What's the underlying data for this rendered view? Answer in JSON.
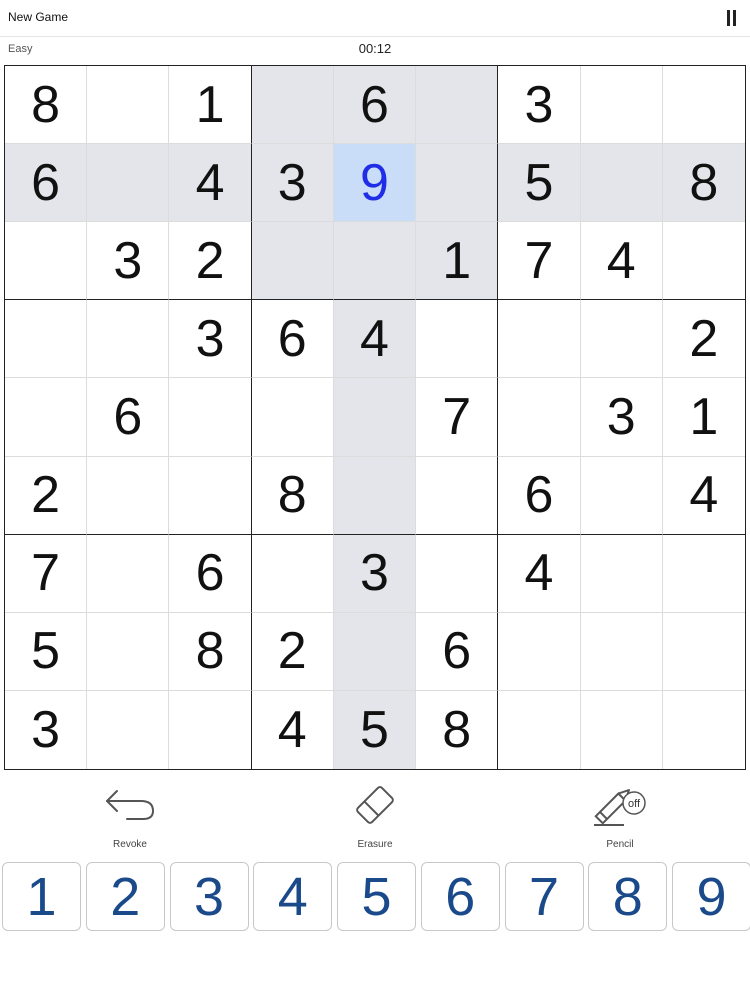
{
  "header": {
    "new_game": "New Game",
    "pause_icon": "pause-icon"
  },
  "info": {
    "difficulty": "Easy",
    "timer": "00:12"
  },
  "board": {
    "cells": [
      [
        "8",
        "",
        "1",
        "",
        "6",
        "",
        "3",
        "",
        ""
      ],
      [
        "6",
        "",
        "4",
        "3",
        "9",
        "",
        "5",
        "",
        "8"
      ],
      [
        "",
        "3",
        "2",
        "",
        "",
        "1",
        "7",
        "4",
        ""
      ],
      [
        "",
        "",
        "3",
        "6",
        "4",
        "",
        "",
        "",
        "2"
      ],
      [
        "",
        "6",
        "",
        "",
        "",
        "7",
        "",
        "3",
        "1"
      ],
      [
        "2",
        "",
        "",
        "8",
        "",
        "",
        "6",
        "",
        "4"
      ],
      [
        "7",
        "",
        "6",
        "",
        "3",
        "",
        "4",
        "",
        ""
      ],
      [
        "5",
        "",
        "8",
        "2",
        "",
        "6",
        "",
        "",
        ""
      ],
      [
        "3",
        "",
        "",
        "4",
        "5",
        "8",
        "",
        "",
        ""
      ]
    ],
    "selected": {
      "row": 1,
      "col": 4
    },
    "colors": {
      "selected_bg": "#c9dcf8",
      "selected_text": "#1f2ee6",
      "highlight_bg": "#e3e5ea"
    }
  },
  "tools": {
    "revoke": {
      "label": "Revoke",
      "icon": "undo-arrow-icon"
    },
    "erasure": {
      "label": "Erasure",
      "icon": "eraser-icon"
    },
    "pencil": {
      "label": "Pencil",
      "icon": "pencil-icon",
      "badge": "off"
    }
  },
  "numpad": {
    "keys": [
      "1",
      "2",
      "3",
      "4",
      "5",
      "6",
      "7",
      "8",
      "9"
    ],
    "color": "#1a4a8a"
  }
}
